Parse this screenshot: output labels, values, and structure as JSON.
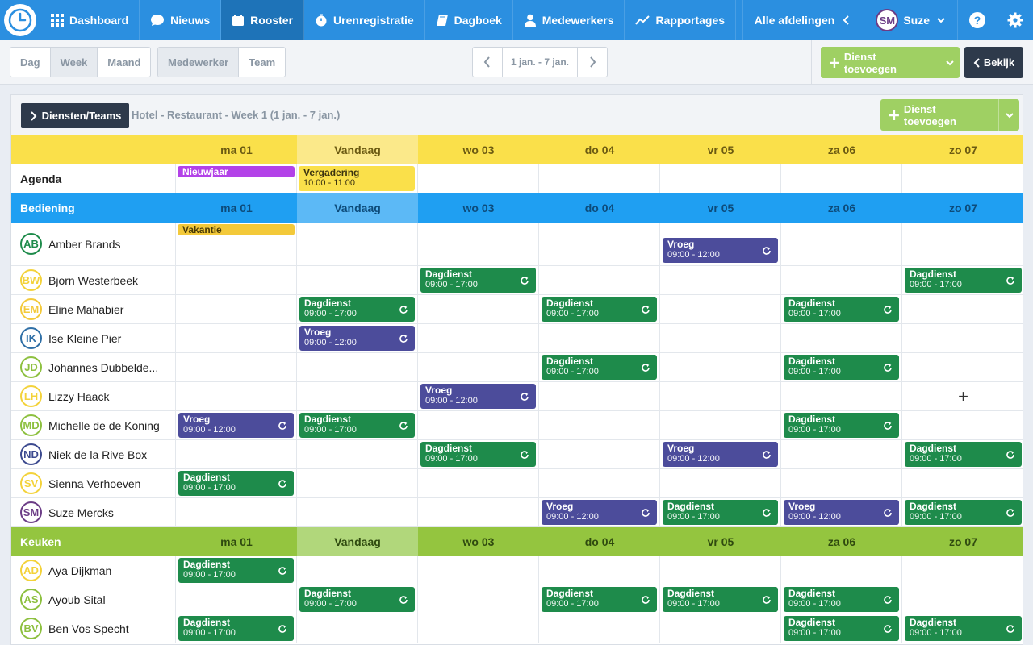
{
  "nav": {
    "items": [
      {
        "label": "Dashboard",
        "icon": "grid-icon"
      },
      {
        "label": "Nieuws",
        "icon": "chat-icon"
      },
      {
        "label": "Rooster",
        "icon": "calendar-icon"
      },
      {
        "label": "Urenregistratie",
        "icon": "timer-icon"
      },
      {
        "label": "Dagboek",
        "icon": "book-icon"
      },
      {
        "label": "Medewerkers",
        "icon": "person-icon"
      },
      {
        "label": "Rapportages",
        "icon": "chart-icon"
      }
    ],
    "department": "Alle afdelingen",
    "user_initials": "SM",
    "user_name": "Suze"
  },
  "toolbar": {
    "view_options": [
      "Dag",
      "Week",
      "Maand"
    ],
    "group_options": [
      "Medewerker",
      "Team"
    ],
    "date_range": "1 jan. - 7 jan.",
    "add_shift": "Dienst toevoegen",
    "view_button": "Bekijk"
  },
  "panel": {
    "teams_button": "Diensten/Teams",
    "title": "Hotel - Restaurant - Week 1 (1 jan. - 7 jan.)",
    "add_shift": "Dienst toevoegen"
  },
  "days": [
    "ma 01",
    "Vandaag",
    "wo 03",
    "do 04",
    "vr 05",
    "za 06",
    "zo 07"
  ],
  "agenda": {
    "label": "Agenda",
    "tag": "Nieuwjaar",
    "event_title": "Vergadering",
    "event_time": "10:00 - 11:00"
  },
  "shift_labels": {
    "day": "Dagdienst",
    "day_time": "09:00 - 17:00",
    "early": "Vroeg",
    "early_time": "09:00 - 12:00",
    "vacation": "Vakantie"
  },
  "sections": [
    {
      "name": "Bediening",
      "employees": [
        {
          "initials": "AB",
          "name": "Amber Brands"
        },
        {
          "initials": "BW",
          "name": "Bjorn Westerbeek"
        },
        {
          "initials": "EM",
          "name": "Eline Mahabier"
        },
        {
          "initials": "IK",
          "name": "Ise Kleine Pier"
        },
        {
          "initials": "JD",
          "name": "Johannes Dubbelde..."
        },
        {
          "initials": "LH",
          "name": "Lizzy Haack"
        },
        {
          "initials": "MD",
          "name": "Michelle de de Koning"
        },
        {
          "initials": "ND",
          "name": "Niek de la Rive Box"
        },
        {
          "initials": "SV",
          "name": "Sienna Verhoeven"
        },
        {
          "initials": "SM",
          "name": "Suze Mercks"
        }
      ]
    },
    {
      "name": "Keuken",
      "employees": [
        {
          "initials": "AD",
          "name": "Aya Dijkman"
        },
        {
          "initials": "AS",
          "name": "Ayoub Sital"
        },
        {
          "initials": "BV",
          "name": "Ben Vos Specht"
        }
      ]
    }
  ],
  "colors": {
    "nav_blue": "#2b8fe0",
    "shift_green": "#1e8b4b",
    "shift_purple": "#4c4c9b",
    "agenda_yellow": "#fae04a",
    "bediening_blue": "#1f9ff2",
    "keuken_green": "#94c53f",
    "button_green": "#9fd063"
  }
}
